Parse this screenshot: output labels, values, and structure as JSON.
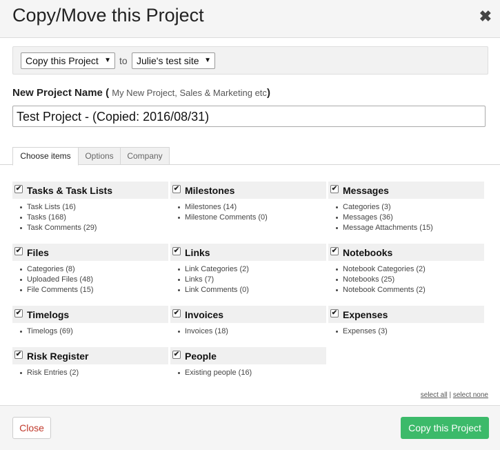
{
  "dialog": {
    "title": "Copy/Move this Project",
    "close_glyph": "✖"
  },
  "target": {
    "action_value": "Copy this Project",
    "to_label": "to",
    "site_value": "Julie's test site"
  },
  "project_name": {
    "label": "New Project Name",
    "hint_open": "(",
    "hint": "My New Project, Sales & Marketing etc",
    "hint_close": ")",
    "value": "Test Project - (Copied: 2016/08/31)"
  },
  "tabs": [
    "Choose items",
    "Options",
    "Company"
  ],
  "groups": [
    {
      "title": "Tasks & Task Lists",
      "checked": true,
      "items": [
        "Task Lists (16)",
        "Tasks (168)",
        "Task Comments (29)"
      ]
    },
    {
      "title": "Milestones",
      "checked": true,
      "items": [
        "Milestones (14)",
        "Milestone Comments (0)"
      ]
    },
    {
      "title": "Messages",
      "checked": true,
      "items": [
        "Categories (3)",
        "Messages (36)",
        "Message Attachments (15)"
      ]
    },
    {
      "title": "Files",
      "checked": true,
      "items": [
        "Categories (8)",
        "Uploaded Files (48)",
        "File Comments (15)"
      ]
    },
    {
      "title": "Links",
      "checked": true,
      "items": [
        "Link Categories (2)",
        "Links (7)",
        "Link Comments (0)"
      ]
    },
    {
      "title": "Notebooks",
      "checked": true,
      "items": [
        "Notebook Categories (2)",
        "Notebooks (25)",
        "Notebook Comments (2)"
      ]
    },
    {
      "title": "Timelogs",
      "checked": true,
      "items": [
        "Timelogs (69)"
      ]
    },
    {
      "title": "Invoices",
      "checked": true,
      "items": [
        "Invoices (18)"
      ]
    },
    {
      "title": "Expenses",
      "checked": true,
      "items": [
        "Expenses (3)"
      ]
    },
    {
      "title": "Risk Register",
      "checked": true,
      "items": [
        "Risk Entries (2)"
      ]
    },
    {
      "title": "People",
      "checked": true,
      "items": [
        "Existing people (16)"
      ]
    }
  ],
  "select_links": {
    "all": "select all",
    "separator": "|",
    "none": "select none"
  },
  "footer": {
    "close_label": "Close",
    "copy_label": "Copy this Project"
  },
  "colors": {
    "primary_button": "#3cba6a",
    "close_text": "#c0392b"
  }
}
